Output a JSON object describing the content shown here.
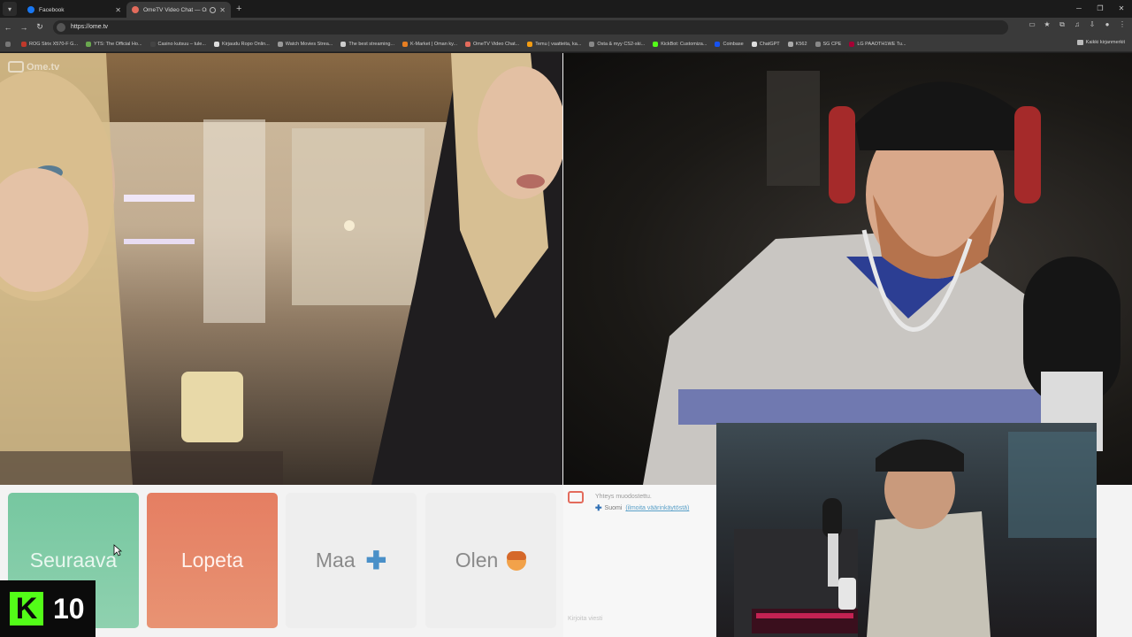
{
  "browser": {
    "tabs": [
      {
        "title": "Facebook",
        "favicon_color": "#1877f2",
        "active": false
      },
      {
        "title": "OmeTV Video Chat — Ome",
        "favicon_color": "#e36b5c",
        "active": true
      }
    ],
    "url": "https://ome.tv",
    "bookmarks": [
      {
        "label": "ROG Strix X570-F G...",
        "color": "#c0392b"
      },
      {
        "label": "YTS: The Official Ho...",
        "color": "#6aa84f"
      },
      {
        "label": "Casino kutsuu – tule...",
        "color": "#444444"
      },
      {
        "label": "Kirjaudu Ropo Onlin...",
        "color": "#dddddd"
      },
      {
        "label": "Watch Movies Strea...",
        "color": "#999999"
      },
      {
        "label": "The best streaming...",
        "color": "#cccccc"
      },
      {
        "label": "K-Market | Oman ky...",
        "color": "#e67e22"
      },
      {
        "label": "OmeTV Video Chat...",
        "color": "#e36b5c"
      },
      {
        "label": "Temu | vaatteita, ka...",
        "color": "#f39c12"
      },
      {
        "label": "Osta & myy CS2-ski...",
        "color": "#888888"
      },
      {
        "label": "KickBot: Customiza...",
        "color": "#53fc18"
      },
      {
        "label": "Coinbase",
        "color": "#1652f0"
      },
      {
        "label": "ChatGPT",
        "color": "#dddddd"
      },
      {
        "label": "K562",
        "color": "#aaaaaa"
      },
      {
        "label": "SG CPE",
        "color": "#888888"
      },
      {
        "label": "LG PAAOTH1WE Tu...",
        "color": "#a50034"
      }
    ],
    "all_bookmarks": "Kaikki kirjanmerkit"
  },
  "logo_text": "Ome.tv",
  "buttons": {
    "next": "Seuraava",
    "stop": "Lopeta",
    "country": "Maa",
    "gender": "Olen"
  },
  "chat": {
    "status": "Yhteys muodostettu.",
    "country": "Suomi",
    "country_link": "(ilmoita väärinkäytöstä)",
    "input_placeholder": "Kirjoita viesti"
  },
  "overlay": {
    "kick_letter": "K",
    "kick_count": "10"
  },
  "colors": {
    "next_button": "#76c7a0",
    "stop_button": "#e57e62",
    "kick_green": "#53fc18"
  }
}
